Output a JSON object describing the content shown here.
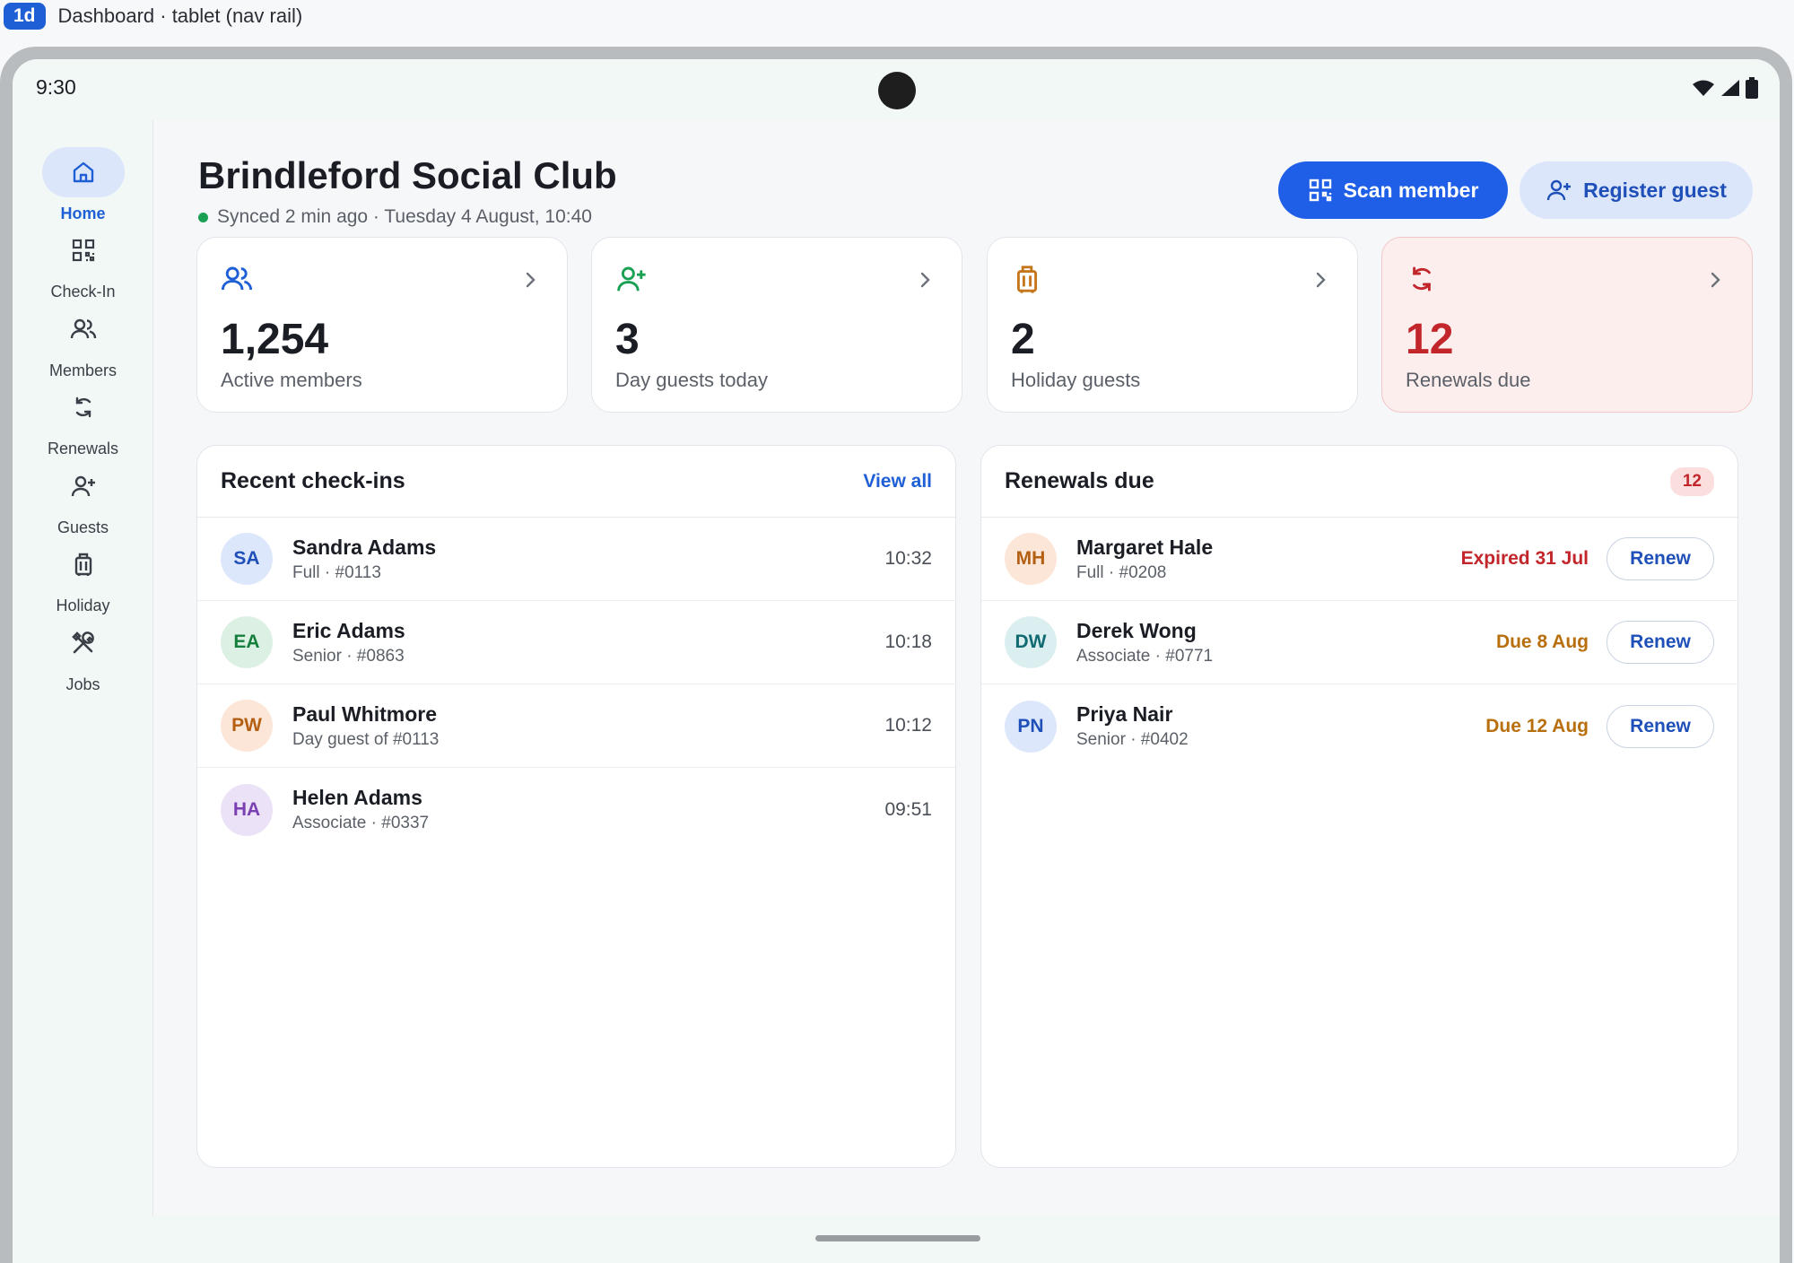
{
  "caption": {
    "tag": "1d",
    "title": "Dashboard · tablet (nav rail)"
  },
  "status": {
    "time": "9:30"
  },
  "rail": [
    {
      "label": "Home",
      "icon": "home-icon",
      "active": true
    },
    {
      "label": "Check-In",
      "icon": "qr-code-icon"
    },
    {
      "label": "Members",
      "icon": "people-icon"
    },
    {
      "label": "Renewals",
      "icon": "refresh-icon"
    },
    {
      "label": "Guests",
      "icon": "person-add-icon"
    },
    {
      "label": "Holiday",
      "icon": "luggage-icon"
    },
    {
      "label": "Jobs",
      "icon": "tools-icon"
    }
  ],
  "header": {
    "title": "Brindleford Social Club",
    "sync": "Synced 2 min ago · Tuesday 4 August, 10:40",
    "scan_label": "Scan member",
    "register_label": "Register guest"
  },
  "stats": [
    {
      "value": "1,254",
      "label": "Active members",
      "icon": "people-icon",
      "color": "#1f5fd6"
    },
    {
      "value": "3",
      "label": "Day guests today",
      "icon": "person-add-icon",
      "color": "#1aa053"
    },
    {
      "value": "2",
      "label": "Holiday guests",
      "icon": "luggage-icon",
      "color": "#c6761a"
    },
    {
      "value": "12",
      "label": "Renewals due",
      "icon": "refresh-icon",
      "color": "#c2262b",
      "alert": true
    }
  ],
  "checkins": {
    "title": "Recent check-ins",
    "view_all": "View all",
    "rows": [
      {
        "initials": "SA",
        "name": "Sandra Adams",
        "meta": "Full · #0113",
        "time": "10:32",
        "bg": "#dde7fb",
        "fg": "#1f4fb8"
      },
      {
        "initials": "EA",
        "name": "Eric Adams",
        "meta": "Senior · #0863",
        "time": "10:18",
        "bg": "#dcf1e4",
        "fg": "#15803d"
      },
      {
        "initials": "PW",
        "name": "Paul Whitmore",
        "meta": "Day guest of #0113",
        "time": "10:12",
        "bg": "#fce6d8",
        "fg": "#b45f12"
      },
      {
        "initials": "HA",
        "name": "Helen Adams",
        "meta": "Associate · #0337",
        "time": "09:51",
        "bg": "#ece2f7",
        "fg": "#7a3fb2"
      }
    ]
  },
  "renewals": {
    "title": "Renewals due",
    "count": "12",
    "renew_label": "Renew",
    "rows": [
      {
        "initials": "MH",
        "name": "Margaret Hale",
        "meta": "Full · #0208",
        "due": "Expired 31 Jul",
        "due_color": "#c2262b",
        "bg": "#fce6d8",
        "fg": "#b45f12"
      },
      {
        "initials": "DW",
        "name": "Derek Wong",
        "meta": "Associate · #0771",
        "due": "Due 8 Aug",
        "due_color": "#b8700f",
        "bg": "#dceff0",
        "fg": "#0f6a72"
      },
      {
        "initials": "PN",
        "name": "Priya Nair",
        "meta": "Senior · #0402",
        "due": "Due 12 Aug",
        "due_color": "#b8700f",
        "bg": "#dde7fb",
        "fg": "#1f4fb8"
      }
    ]
  }
}
